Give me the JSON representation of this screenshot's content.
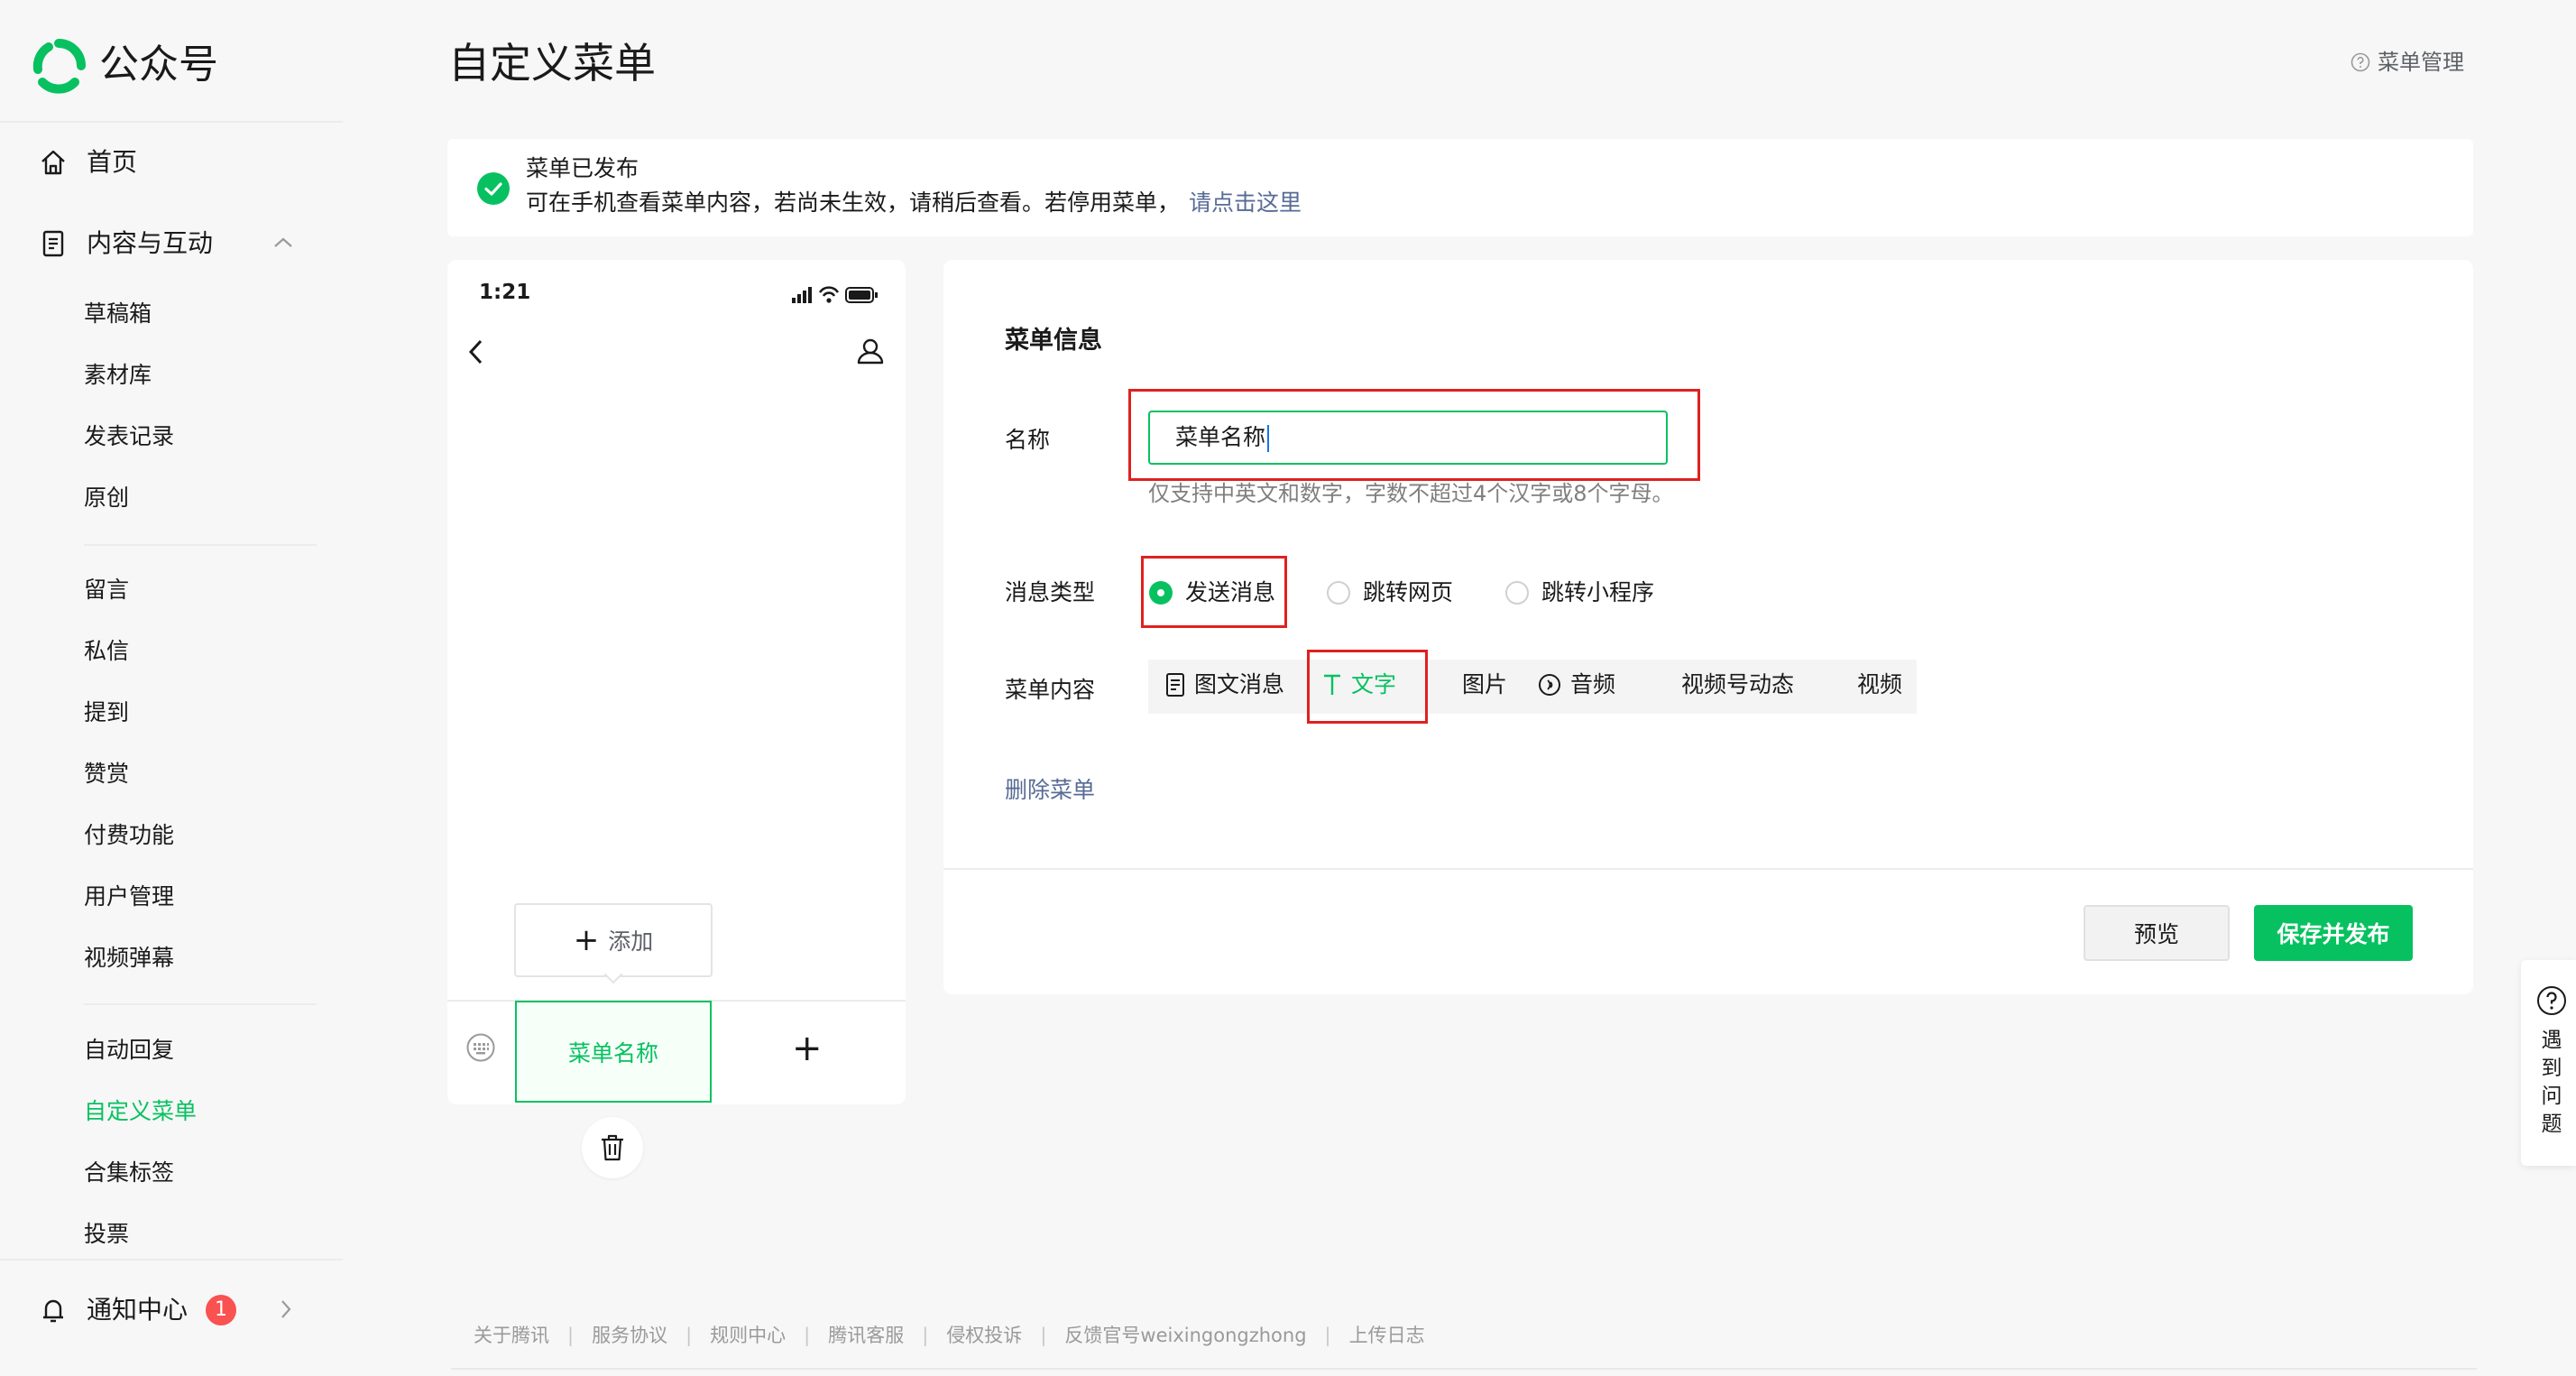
{
  "brand": {
    "logo_text": "公众号",
    "accent": "#07c160"
  },
  "sidebar": {
    "home": "首页",
    "content_group": "内容与互动",
    "group1": [
      "草稿箱",
      "素材库",
      "发表记录",
      "原创"
    ],
    "group2": [
      "留言",
      "私信",
      "提到",
      "赞赏",
      "付费功能",
      "用户管理",
      "视频弹幕"
    ],
    "group3": [
      "自动回复",
      "自定义菜单",
      "合集标签",
      "投票"
    ],
    "active": "自定义菜单",
    "notifications": {
      "label": "通知中心",
      "count": "1"
    }
  },
  "header": {
    "title": "自定义菜单",
    "menu_manage": "菜单管理"
  },
  "notice": {
    "title": "菜单已发布",
    "desc": "可在手机查看菜单内容，若尚未生效，请稍后查看。若停用菜单，",
    "link": "请点击这里"
  },
  "phone": {
    "time": "1:21",
    "add_label": "添加",
    "menu_item": "菜单名称"
  },
  "editor": {
    "section_title": "菜单信息",
    "name_label": "名称",
    "name_value": "菜单名称",
    "name_hint": "仅支持中英文和数字，字数不超过4个汉字或8个字母。",
    "msg_type_label": "消息类型",
    "msg_types": [
      "发送消息",
      "跳转网页",
      "跳转小程序"
    ],
    "selected_msg_type": "发送消息",
    "content_label": "菜单内容",
    "content_tabs": [
      "图文消息",
      "文字",
      "图片",
      "音频",
      "视频号动态",
      "视频"
    ],
    "selected_content_tab": "文字",
    "delete_label": "删除菜单",
    "preview_label": "预览",
    "save_label": "保存并发布"
  },
  "help": {
    "label": "遇到问题"
  },
  "footer": {
    "links": [
      "关于腾讯",
      "服务协议",
      "规则中心",
      "腾讯客服",
      "侵权投诉",
      "反馈官号weixingongzhong",
      "上传日志"
    ]
  }
}
